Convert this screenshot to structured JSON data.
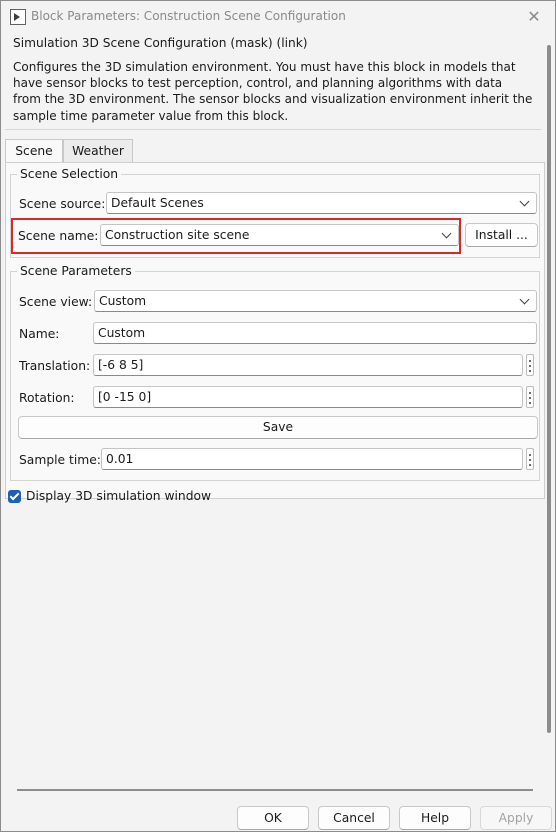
{
  "window": {
    "title": "Block Parameters: Construction Scene Configuration",
    "close_glyph": "✕"
  },
  "mask": {
    "title": "Simulation 3D Scene Configuration (mask) (link)",
    "description": "Configures the 3D simulation environment. You must have this block in models that have sensor blocks to test perception, control, and planning algorithms with data from the 3D environment. The sensor blocks and visualization environment inherit the sample time parameter value from this block."
  },
  "tabs": [
    {
      "label": "Scene",
      "active": true
    },
    {
      "label": "Weather",
      "active": false
    }
  ],
  "scene_selection": {
    "title": "Scene Selection",
    "source_label": "Scene source:",
    "source_value": "Default Scenes",
    "name_label": "Scene name:",
    "name_value": "Construction site scene",
    "install_label": "Install ..."
  },
  "scene_parameters": {
    "title": "Scene Parameters",
    "view_label": "Scene view:",
    "view_value": "Custom",
    "name_label": "Name:",
    "name_value": "Custom",
    "translation_label": "Translation:",
    "translation_value": "[-6 8 5]",
    "rotation_label": "Rotation:",
    "rotation_value": "[0 -15 0]",
    "save_label": "Save",
    "sample_time_label": "Sample time:",
    "sample_time_value": "0.01"
  },
  "display_window": {
    "label": "Display 3D simulation window",
    "checked": true
  },
  "footer": {
    "ok": "OK",
    "cancel": "Cancel",
    "help": "Help",
    "apply": "Apply"
  },
  "colors": {
    "highlight": "#d42a2a",
    "checkbox": "#1d5fb6"
  }
}
